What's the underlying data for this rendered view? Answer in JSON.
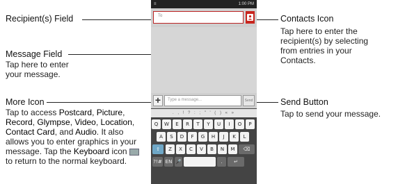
{
  "phone": {
    "status_left": "≡",
    "status_time": "1:00 PM",
    "recipient_placeholder": "To",
    "message_placeholder": "Type a message...",
    "more_label": "+",
    "send_label": "Send",
    "symbol_row": ". , ! ? : ; \" ' ( ) « »",
    "keys_row1": [
      "Q",
      "W",
      "E",
      "R",
      "T",
      "Y",
      "U",
      "I",
      "O",
      "P"
    ],
    "keys_row2": [
      "A",
      "S",
      "D",
      "F",
      "G",
      "H",
      "J",
      "K",
      "L"
    ],
    "keys_row3": [
      "Z",
      "X",
      "C",
      "V",
      "B",
      "N",
      "M"
    ],
    "key_sym": "?!#",
    "key_lang": "EN"
  },
  "callouts": {
    "recipient_title": "Recipient(s) Field",
    "message_title": "Message Field",
    "message_desc": "Tap here to enter your message.",
    "more_title": "More Icon",
    "more_desc_parts": {
      "p1": "Tap to access ",
      "postcard": "Postcard",
      "c1": ", ",
      "picture": "Picture",
      "c2": ", ",
      "record": "Record",
      "c3": ", ",
      "glympse": "Glympse",
      "c4": ", ",
      "video": "Video",
      "c5": ", ",
      "location": "Location",
      "c6": ", ",
      "contact_card": "Contact Card",
      "c7": ", and ",
      "audio": "Audio",
      "p2": ". It also allows you to enter graphics in your message. Tap the ",
      "keyboard": "Keyboard",
      "p3": " icon ",
      "p4": " to return to the normal keyboard."
    },
    "contacts_title": "Contacts Icon",
    "contacts_desc": "Tap here to enter the recipient(s) by selecting from entries in your Contacts.",
    "send_title": "Send Button",
    "send_desc": "Tap to send your message."
  }
}
